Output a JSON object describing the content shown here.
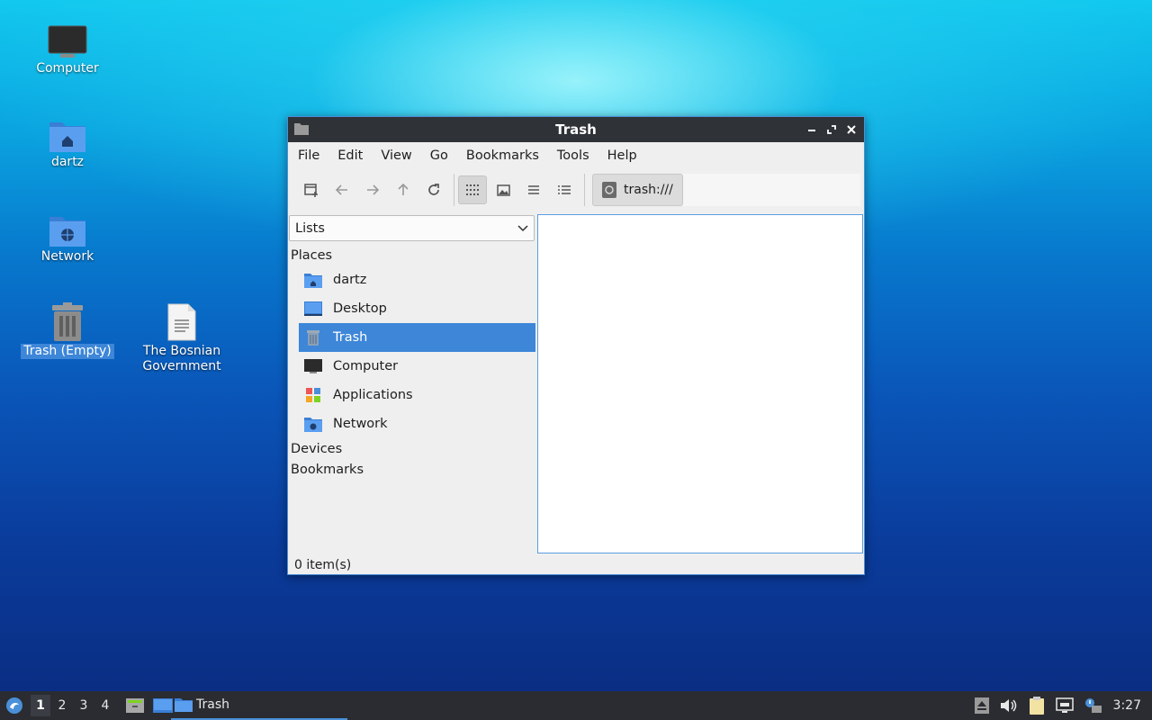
{
  "desktop": {
    "icons": [
      {
        "label": "Computer"
      },
      {
        "label": "dartz"
      },
      {
        "label": "Network"
      },
      {
        "label": "Trash (Empty)"
      },
      {
        "label": "The Bosnian Government"
      }
    ]
  },
  "window": {
    "title": "Trash",
    "menu": [
      "File",
      "Edit",
      "View",
      "Go",
      "Bookmarks",
      "Tools",
      "Help"
    ],
    "address": "trash:///",
    "side_pane_mode": "Lists",
    "sections": {
      "places": "Places",
      "devices": "Devices",
      "bookmarks": "Bookmarks"
    },
    "places": [
      {
        "label": "dartz",
        "icon": "home-folder-icon"
      },
      {
        "label": "Desktop",
        "icon": "desktop-icon"
      },
      {
        "label": "Trash",
        "icon": "trash-icon",
        "selected": true
      },
      {
        "label": "Computer",
        "icon": "computer-icon"
      },
      {
        "label": "Applications",
        "icon": "applications-icon"
      },
      {
        "label": "Network",
        "icon": "network-folder-icon"
      }
    ],
    "status": "0 item(s)"
  },
  "taskbar": {
    "workspaces": [
      "1",
      "2",
      "3",
      "4"
    ],
    "active_workspace": "1",
    "task": "Trash",
    "clock": "3:27"
  },
  "colors": {
    "accent": "#3d86d8",
    "titlebar": "#2f3237",
    "taskbar": "#2a2c31"
  }
}
